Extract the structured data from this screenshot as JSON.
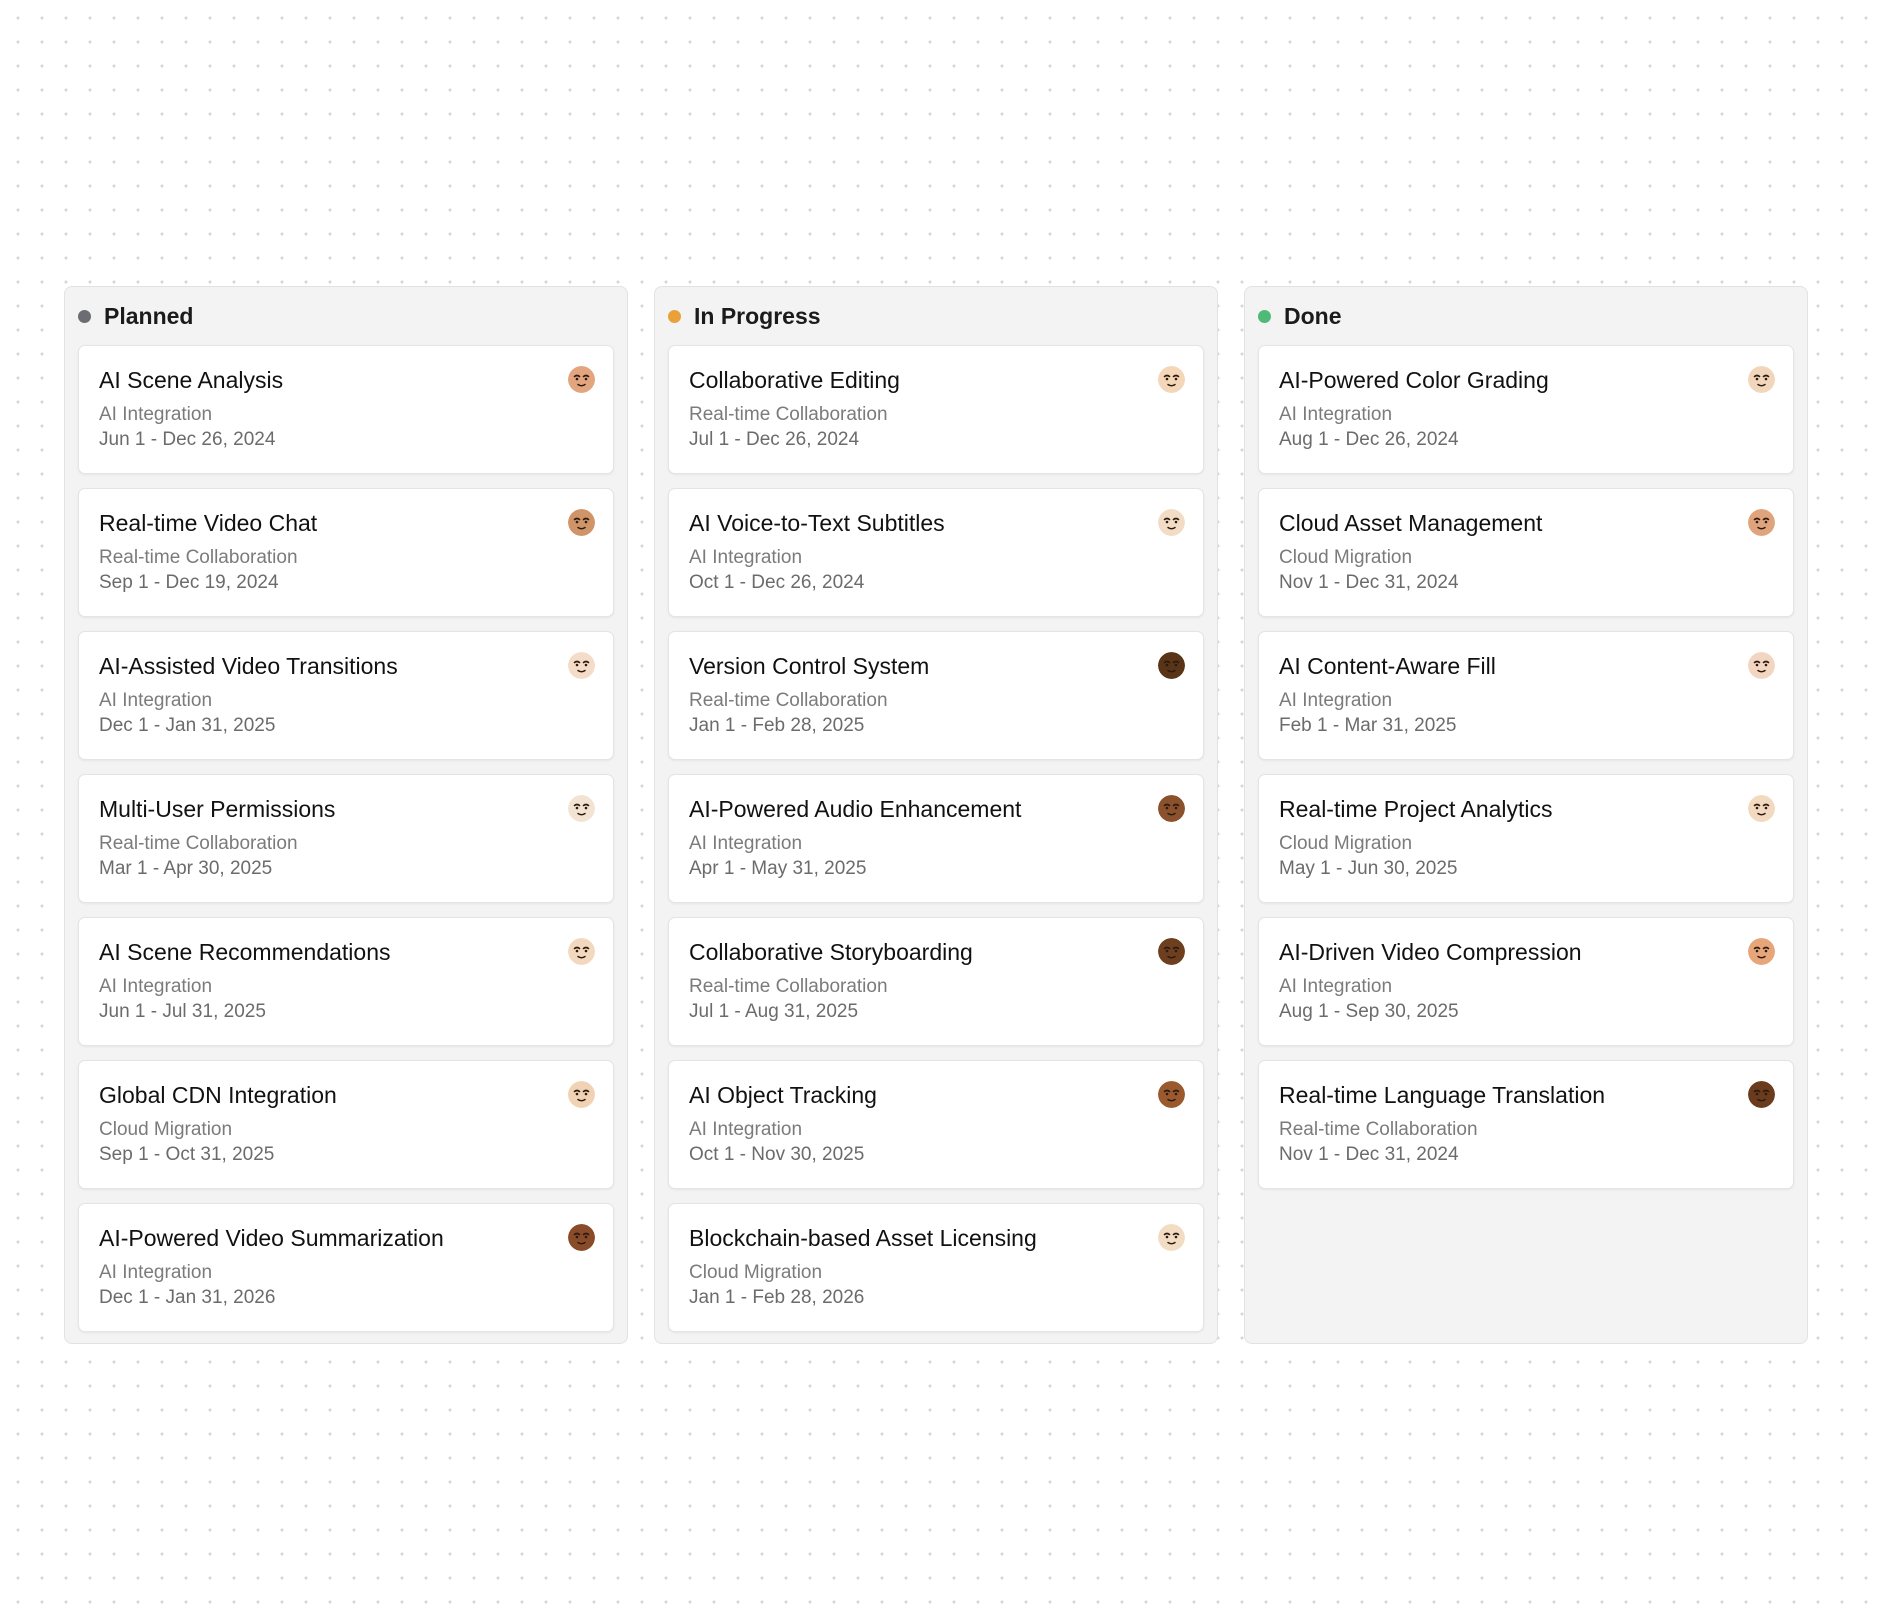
{
  "board": {
    "columns": [
      {
        "title": "Planned",
        "dot_color": "#6b6d72",
        "cards": [
          {
            "title": "AI Scene Analysis",
            "category": "AI Integration",
            "dates": "Jun 1 - Dec 26, 2024",
            "avatar_skin": "#e3a57f",
            "avatar_icon": "squint-face-icon"
          },
          {
            "title": "Real-time Video Chat",
            "category": "Real-time Collaboration",
            "dates": "Sep 1 - Dec 19, 2024",
            "avatar_skin": "#cf9468",
            "avatar_icon": "glasses-face-icon"
          },
          {
            "title": "AI-Assisted Video Transitions",
            "category": "AI Integration",
            "dates": "Dec 1 - Jan 31, 2025",
            "avatar_skin": "#f4dcc8",
            "avatar_icon": "surprised-face-icon"
          },
          {
            "title": "Multi-User Permissions",
            "category": "Real-time Collaboration",
            "dates": "Mar 1 - Apr 30, 2025",
            "avatar_skin": "#f2e3d3",
            "avatar_icon": "calm-face-icon"
          },
          {
            "title": "AI Scene Recommendations",
            "category": "AI Integration",
            "dates": "Jun 1 - Jul 31, 2025",
            "avatar_skin": "#f3d8c0",
            "avatar_icon": "angry-face-icon"
          },
          {
            "title": "Global CDN Integration",
            "category": "Cloud Migration",
            "dates": "Sep 1 - Oct 31, 2025",
            "avatar_skin": "#f1d2b5",
            "avatar_icon": "worried-face-icon"
          },
          {
            "title": "AI-Powered Video Summarization",
            "category": "AI Integration",
            "dates": "Dec 1 - Jan 31, 2026",
            "avatar_skin": "#8a4b2a",
            "avatar_icon": "shocked-face-icon"
          }
        ]
      },
      {
        "title": "In Progress",
        "dot_color": "#eba13a",
        "cards": [
          {
            "title": "Collaborative Editing",
            "category": "Real-time Collaboration",
            "dates": "Jul 1 - Dec 26, 2024",
            "avatar_skin": "#f4d6b8",
            "avatar_icon": "happy-face-icon"
          },
          {
            "title": "AI Voice-to-Text Subtitles",
            "category": "AI Integration",
            "dates": "Oct 1 - Dec 26, 2024",
            "avatar_skin": "#f2dcc6",
            "avatar_icon": "thinking-face-icon"
          },
          {
            "title": "Version Control System",
            "category": "Real-time Collaboration",
            "dates": "Jan 1 - Feb 28, 2025",
            "avatar_skin": "#5a3416",
            "avatar_icon": "sleepy-face-icon"
          },
          {
            "title": "AI-Powered Audio Enhancement",
            "category": "AI Integration",
            "dates": "Apr 1 - May 31, 2025",
            "avatar_skin": "#8b512c",
            "avatar_icon": "whistle-face-icon"
          },
          {
            "title": "Collaborative Storyboarding",
            "category": "Real-time Collaboration",
            "dates": "Jul 1 - Aug 31, 2025",
            "avatar_skin": "#6e3f1f",
            "avatar_icon": "wink-face-icon"
          },
          {
            "title": "AI Object Tracking",
            "category": "AI Integration",
            "dates": "Oct 1 - Nov 30, 2025",
            "avatar_skin": "#9b5a2e",
            "avatar_icon": "side-eye-face-icon"
          },
          {
            "title": "Blockchain-based Asset Licensing",
            "category": "Cloud Migration",
            "dates": "Jan 1 - Feb 28, 2026",
            "avatar_skin": "#f3dcc4",
            "avatar_icon": "grin-face-icon"
          }
        ]
      },
      {
        "title": "Done",
        "dot_color": "#4fba78",
        "cards": [
          {
            "title": "AI-Powered Color Grading",
            "category": "AI Integration",
            "dates": "Aug 1 - Dec 26, 2024",
            "avatar_skin": "#f1d6bb",
            "avatar_icon": "smirk-face-icon"
          },
          {
            "title": "Cloud Asset Management",
            "category": "Cloud Migration",
            "dates": "Nov 1 - Dec 31, 2024",
            "avatar_skin": "#e0a47c",
            "avatar_icon": "puzzled-face-icon"
          },
          {
            "title": "AI Content-Aware Fill",
            "category": "AI Integration",
            "dates": "Feb 1 - Mar 31, 2025",
            "avatar_skin": "#f3d6c2",
            "avatar_icon": "tongue-face-icon"
          },
          {
            "title": "Real-time Project Analytics",
            "category": "Cloud Migration",
            "dates": "May 1 - Jun 30, 2025",
            "avatar_skin": "#f2d9bf",
            "avatar_icon": "wink-face-icon"
          },
          {
            "title": "AI-Driven Video Compression",
            "category": "AI Integration",
            "dates": "Aug 1 - Sep 30, 2025",
            "avatar_skin": "#e7a57a",
            "avatar_icon": "determined-face-icon"
          },
          {
            "title": "Real-time Language Translation",
            "category": "Real-time Collaboration",
            "dates": "Nov 1 - Dec 31, 2024",
            "avatar_skin": "#6b3b1d",
            "avatar_icon": "cool-face-icon"
          }
        ]
      }
    ]
  }
}
